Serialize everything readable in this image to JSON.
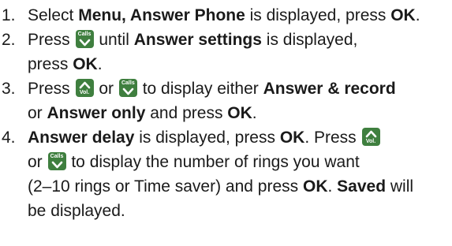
{
  "keys": {
    "calls_label": "Calls",
    "vol_label": "Vol.",
    "key_color": "#3f7f3f"
  },
  "steps": [
    {
      "number": "1.",
      "parts": [
        "Select ",
        "Menu, Answer Phone",
        " is displayed, press ",
        "OK",
        "."
      ]
    },
    {
      "number": "2.",
      "parts": [
        "Press ",
        " until ",
        "Answer settings",
        " is displayed,",
        "press ",
        "OK",
        "."
      ]
    },
    {
      "number": "3.",
      "parts": [
        "Press ",
        " or ",
        " to display either ",
        "Answer & record",
        "or ",
        "Answer only",
        " and press ",
        "OK",
        "."
      ]
    },
    {
      "number": "4.",
      "parts": [
        "Answer delay",
        " is displayed, press ",
        "OK",
        ".  Press ",
        "or ",
        " to display the number of rings you want",
        "(2–10 rings or Time saver) and press ",
        "OK",
        ". ",
        "Saved",
        " will",
        "be displayed."
      ]
    }
  ]
}
